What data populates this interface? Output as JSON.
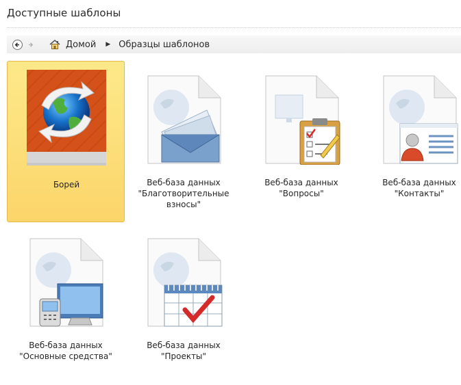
{
  "header": {
    "title": "Доступные шаблоны"
  },
  "breadcrumb": {
    "home_label": "Домой",
    "current_label": "Образцы шаблонов"
  },
  "templates": [
    {
      "label": "Борей",
      "icon": "borey-globe-icon",
      "selected": true
    },
    {
      "label": "Веб-база данных\n\"Благотворительные\nвзносы\"",
      "icon": "envelope-icon",
      "selected": false
    },
    {
      "label": "Веб-база данных\n\"Вопросы\"",
      "icon": "clipboard-checklist-icon",
      "selected": false
    },
    {
      "label": "Веб-база данных\n\"Контакты\"",
      "icon": "contact-card-icon",
      "selected": false
    },
    {
      "label": "Веб-база данных\n\"Основные средства\"",
      "icon": "computer-phone-icon",
      "selected": false
    },
    {
      "label": "Веб-база данных\n\"Проекты\"",
      "icon": "calendar-check-icon",
      "selected": false
    }
  ],
  "colors": {
    "selected_bg": "#fcd56a",
    "borey_bg": "#d4521a",
    "check_red": "#d42a2a"
  }
}
